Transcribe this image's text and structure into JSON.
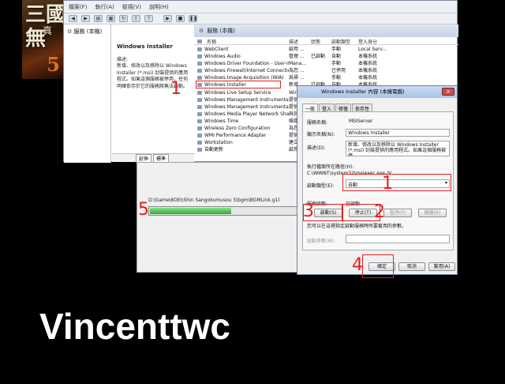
{
  "cover": {
    "title_chars": "三國\n無",
    "title_sub": "真",
    "number": "5"
  },
  "services": {
    "menu": [
      "檔案(F)",
      "執行(A)",
      "檢視(V)",
      "說明(H)"
    ],
    "toolbar_icons": [
      "back-icon",
      "forward-icon",
      "folder-icon",
      "properties-icon",
      "refresh-icon",
      "export-icon",
      "help-icon",
      "play-icon",
      "stop-icon",
      "pause-icon"
    ],
    "tree_root": "服務 (本機)",
    "list_header": "服務 (本機)",
    "detail_title": "Windows Installer",
    "detail_desc_label": "描述:",
    "detail_desc": "新增、修改以及移除以 Windows Installer (*.msi) 封裝提供的應用程式。如果這個服務被停用，任何明確依存於它的服務將無法啟動。",
    "columns": [
      "名稱",
      "描述",
      "狀態",
      "啟動類型",
      "登入身分"
    ],
    "rows": [
      [
        "WebClient",
        "啟用 ...",
        "",
        "手動",
        "Local Serv..."
      ],
      [
        "Windows Audio",
        "管理 ...",
        "已啟動",
        "自動",
        "本機系統"
      ],
      [
        "Windows Driver Foundation - User-mod...",
        "Mana...",
        "",
        "手動",
        "本機系統"
      ],
      [
        "Windows Firewall/Internet Connection S...",
        "為您 ...",
        "",
        "已停用",
        "本機系統"
      ],
      [
        "Windows Image Acquisition (WIA)",
        "爲掃 ...",
        "",
        "手動",
        "本機系統"
      ],
      [
        "Windows Installer",
        "新增 ...",
        "已啟動",
        "自動",
        "本機系統"
      ],
      [
        "Windows Live Setup Service",
        "Wind...",
        "",
        "",
        ""
      ],
      [
        "Windows Management Instrumentation",
        "提供 ...",
        "",
        "",
        ""
      ],
      [
        "Windows Management Instrumentation ...",
        "提供 ...",
        "",
        "",
        ""
      ],
      [
        "Windows Media Player Network Sharing...",
        "與其 ...",
        "",
        "",
        ""
      ],
      [
        "Windows Time",
        "維護 ...",
        "",
        "",
        ""
      ],
      [
        "Wireless Zero Configuration",
        "為您 ...",
        "",
        "",
        ""
      ],
      [
        "WMI Performance Adapter",
        "提供 ...",
        "",
        "",
        ""
      ],
      [
        "Workstation",
        "建立 ...",
        "",
        "",
        ""
      ],
      [
        "自動更新",
        "啟用 ...",
        "",
        "",
        ""
      ]
    ],
    "tabs": [
      "延伸",
      "標準"
    ]
  },
  "copy_dialog": {
    "path": "D:\\Game\\KOEI\\Shin Sangokumusou 5\\bgm\\BGMLink.g1l",
    "progress": 0.55
  },
  "properties": {
    "title": "Windows Installer 內容 (本機電腦)",
    "close": "×",
    "tabs": [
      "一般",
      "登入",
      "修復",
      "依存性"
    ],
    "service_name_label": "服務名稱:",
    "service_name": "MSIServer",
    "display_name_label": "顯示名稱(N):",
    "display_name": "Windows Installer",
    "desc_label": "描述(D):",
    "desc": "新增、修改以及移除以 Windows Installer (*.msi) 封裝提供的應用程式。如果這個服務被停",
    "path_label": "執行檔案所在路徑(H):",
    "path": "C:\\WINNT\\system32\\msiexec.exe /V",
    "startup_label": "啟動類型(E):",
    "startup_value": "自動",
    "status_label": "服務狀態:",
    "status_value": "已啟動",
    "buttons": {
      "start": "啟動(S)",
      "stop": "停止(T)",
      "pause": "暫停(P)",
      "resume": "繼續(R)"
    },
    "params_hint": "您可以在這裡指定啟動服務時所要套用的參數。",
    "params_label": "啟動參數(M):",
    "ok": "確定",
    "cancel": "取消",
    "apply": "套用(A)"
  },
  "markers": [
    "1",
    "1",
    "2",
    "3",
    "4",
    "5"
  ],
  "caption": "Vincenttwc",
  "colors": {
    "marker": "#e02020",
    "progress": "#2fa82f"
  }
}
